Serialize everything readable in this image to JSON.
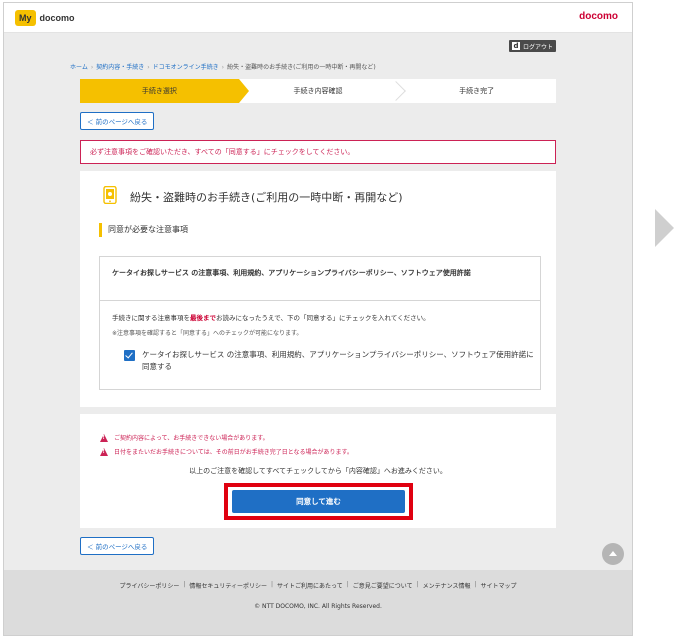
{
  "header": {
    "logo_my": "My",
    "logo_docomo": "docomo",
    "brand": "docomo"
  },
  "subbar": {
    "logout_icon": "d",
    "logout_label": "ログアウト"
  },
  "breadcrumb": [
    {
      "label": "ホーム",
      "link": true
    },
    {
      "label": "契約内容・手続き",
      "link": true
    },
    {
      "label": "ドコモオンライン手続き",
      "link": true
    },
    {
      "label": "紛失・盗難時のお手続き(ご利用の一時中断・再開など)",
      "link": false
    }
  ],
  "steps": [
    {
      "label": "手続き選択",
      "active": true
    },
    {
      "label": "手続き内容確認",
      "active": false
    },
    {
      "label": "手続き完了",
      "active": false
    }
  ],
  "back_button_label": "＜ 前のページへ戻る",
  "alert_text": "必ず注意事項をご確認いただき、すべての「同意する」にチェックをしてください。",
  "main": {
    "page_title": "紛失・盗難時のお手続き(ご利用の一時中断・再開など)",
    "section_title": "同意が必要な注意事項",
    "terms_heading": "ケータイお探しサービス の注意事項、利用規約、アプリケーションプライバシーポリシー、ソフトウェア使用許諾",
    "note_pre": "手続きに関する注意事項を",
    "note_em": "最後まで",
    "note_post": "お読みになったうえで、下の「同意する」にチェックを入れてください。",
    "note_2": "※注意事項を確認すると「同意する」へのチェックが可能になります。",
    "agree_label": "ケータイお探しサービス の注意事項、利用規約、アプリケーションプライバシーポリシー、ソフトウェア使用許諾に同意する",
    "agree_checked": true
  },
  "notice": {
    "warning_1": "ご契約内容によって、お手続きできない場合があります。",
    "warning_2": "日付をまたいだお手続きについては、その前日がお手続き完了日となる場合があります。",
    "confirm_text": "以上のご注意を確認してすべてチェックしてから「内容確認」へお進みください。",
    "submit_label": "同意して進む"
  },
  "footer": {
    "links": [
      "プライバシーポリシー",
      "情報セキュリティーポリシー",
      "サイトご利用にあたって",
      "ご意見ご要望について",
      "メンテナンス情報",
      "サイトマップ"
    ],
    "copyright": "© NTT DOCOMO, INC. All Rights Reserved."
  },
  "colors": {
    "accent_yellow": "#f5c000",
    "link_blue": "#1f6fc5",
    "alert_red": "#cc2255",
    "highlight_red": "#e00010"
  }
}
